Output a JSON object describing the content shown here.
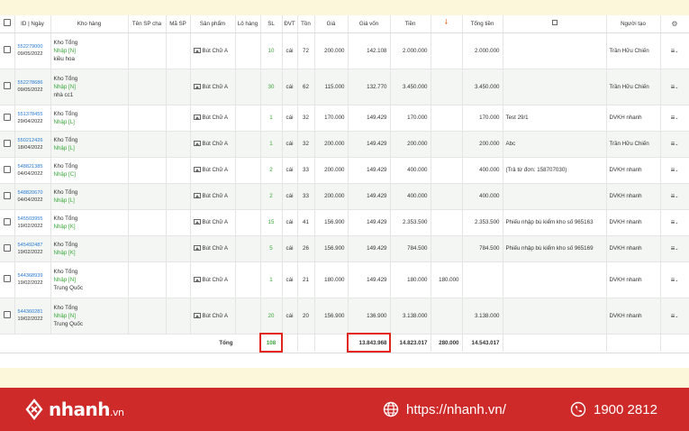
{
  "headers": {
    "id_date": "ID | Ngày",
    "warehouse": "Kho hàng",
    "parent_name": "Tên SP cha",
    "sku": "Mã SP",
    "product": "Sản phẩm",
    "batch": "Lô hàng",
    "qty": "SL",
    "unit": "ĐVT",
    "stock": "Tồn",
    "price": "Giá",
    "cost": "Giá vốn",
    "amount": "Tiền",
    "discount_icon": "arrow-down-icon",
    "total": "Tổng tiền",
    "note_icon": "note-icon",
    "creator": "Người tạo",
    "settings_icon": "gear-icon"
  },
  "rows": [
    {
      "id": "552279000",
      "date": "09/05/2022",
      "wh": "Kho Tổng",
      "type": "Nhập [N]",
      "extra": "kiều hoa",
      "product": "Bút Chữ A",
      "qty": "10",
      "unit": "cái",
      "stock": "72",
      "price": "200.000",
      "cost": "142.108",
      "amount": "2.000.000",
      "discount": "",
      "total": "2.000.000",
      "note": "",
      "creator": "Trần Hữu Chiến"
    },
    {
      "id": "552278686",
      "date": "09/05/2022",
      "wh": "Kho Tổng",
      "type": "Nhập [N]",
      "extra": "nhà cc1",
      "product": "Bút Chữ A",
      "qty": "30",
      "unit": "cái",
      "stock": "62",
      "price": "115.000",
      "cost": "132.770",
      "amount": "3.450.000",
      "discount": "",
      "total": "3.450.000",
      "note": "",
      "creator": "Trần Hữu Chiến"
    },
    {
      "id": "551378455",
      "date": "29/04/2022",
      "wh": "Kho Tổng",
      "type": "Nhập [L]",
      "extra": "",
      "product": "Bút Chữ A",
      "qty": "1",
      "unit": "cái",
      "stock": "32",
      "price": "170.000",
      "cost": "149.429",
      "amount": "170.000",
      "discount": "",
      "total": "170.000",
      "note": "Test 29/1",
      "creator": "DVKH nhanh"
    },
    {
      "id": "550212426",
      "date": "18/04/2022",
      "wh": "Kho Tổng",
      "type": "Nhập [L]",
      "extra": "",
      "product": "Bút Chữ A",
      "qty": "1",
      "unit": "cái",
      "stock": "32",
      "price": "200.000",
      "cost": "149.429",
      "amount": "200.000",
      "discount": "",
      "total": "200.000",
      "note": "Abc",
      "creator": "Trần Hữu Chiến"
    },
    {
      "id": "548821385",
      "date": "04/04/2022",
      "wh": "Kho Tổng",
      "type": "Nhập [C]",
      "extra": "",
      "product": "Bút Chữ A",
      "qty": "2",
      "unit": "cái",
      "stock": "33",
      "price": "200.000",
      "cost": "149.429",
      "amount": "400.000",
      "discount": "",
      "total": "400.000",
      "note": "(Trả từ đơn: 158707030)",
      "creator": "DVKH nhanh"
    },
    {
      "id": "548820670",
      "date": "04/04/2022",
      "wh": "Kho Tổng",
      "type": "Nhập [L]",
      "extra": "",
      "product": "Bút Chữ A",
      "qty": "2",
      "unit": "cái",
      "stock": "33",
      "price": "200.000",
      "cost": "149.429",
      "amount": "400.000",
      "discount": "",
      "total": "400.000",
      "note": "",
      "creator": "DVKH nhanh"
    },
    {
      "id": "545503955",
      "date": "19/02/2022",
      "wh": "Kho Tổng",
      "type": "Nhập [K]",
      "extra": "",
      "product": "Bút Chữ A",
      "qty": "15",
      "unit": "cái",
      "stock": "41",
      "price": "156.900",
      "cost": "149.429",
      "amount": "2.353.500",
      "discount": "",
      "total": "2.353.500",
      "note": "Phiếu nhập bù kiểm kho số 965163",
      "creator": "DVKH nhanh"
    },
    {
      "id": "545492487",
      "date": "19/02/2022",
      "wh": "Kho Tổng",
      "type": "Nhập [K]",
      "extra": "",
      "product": "Bút Chữ A",
      "qty": "5",
      "unit": "cái",
      "stock": "26",
      "price": "156.900",
      "cost": "149.429",
      "amount": "784.500",
      "discount": "",
      "total": "784.500",
      "note": "Phiếu nhập bù kiểm kho số 965169",
      "creator": "DVKH nhanh"
    },
    {
      "id": "544368939",
      "date": "19/02/2022",
      "wh": "Kho Tổng",
      "type": "Nhập [N]",
      "extra": "Trung Quốc",
      "product": "Bút Chữ A",
      "qty": "1",
      "unit": "cái",
      "stock": "21",
      "price": "180.000",
      "cost": "149.429",
      "amount": "180.000",
      "discount": "180.000",
      "total": "",
      "note": "",
      "creator": "DVKH nhanh"
    },
    {
      "id": "544360281",
      "date": "19/02/2022",
      "wh": "Kho Tổng",
      "type": "Nhập [N]",
      "extra": "Trung Quốc",
      "product": "Bút Chữ A",
      "qty": "20",
      "unit": "cái",
      "stock": "20",
      "price": "156.900",
      "cost": "136.900",
      "amount": "3.138.000",
      "discount": "",
      "total": "3.138.000",
      "note": "",
      "creator": "DVKH nhanh"
    }
  ],
  "totals": {
    "label": "Tổng",
    "qty": "108",
    "cost": "13.843.968",
    "amount": "14.823.017",
    "discount": "280.000",
    "total": "14.543.017"
  },
  "footer": {
    "brand": "nhanh",
    "brand_tld": ".vn",
    "website": "https://nhanh.vn/",
    "phone": "1900 2812"
  },
  "colors": {
    "accent_red": "#cf2a2a",
    "link_blue": "#2a7bd6",
    "import_green": "#3aa63a",
    "highlight_box": "#e0261f"
  }
}
